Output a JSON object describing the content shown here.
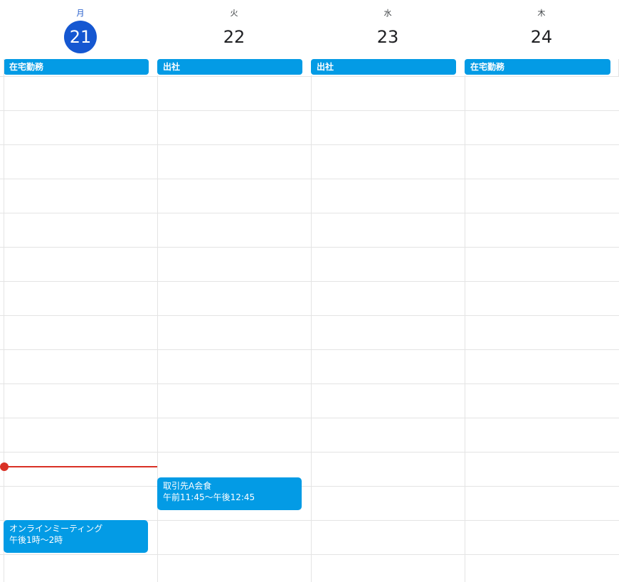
{
  "days": [
    {
      "name": "月",
      "number": "21",
      "today": true
    },
    {
      "name": "火",
      "number": "22",
      "today": false
    },
    {
      "name": "水",
      "number": "23",
      "today": false
    },
    {
      "name": "木",
      "number": "24",
      "today": false
    }
  ],
  "all_day_events": [
    {
      "title": "在宅勤務"
    },
    {
      "title": "出社"
    },
    {
      "title": "出社"
    },
    {
      "title": "在宅勤務"
    }
  ],
  "events": [
    {
      "title": "取引先A会食",
      "time": "午前11:45〜午後12:45"
    },
    {
      "title": "オンラインミーティング",
      "time": "午後1時〜2時"
    }
  ],
  "colors": {
    "event": "#039be5",
    "today_circle": "#1557d1",
    "today_text": "#1a55c8",
    "now_indicator": "#d93025",
    "gridline": "#e4e4e4"
  }
}
